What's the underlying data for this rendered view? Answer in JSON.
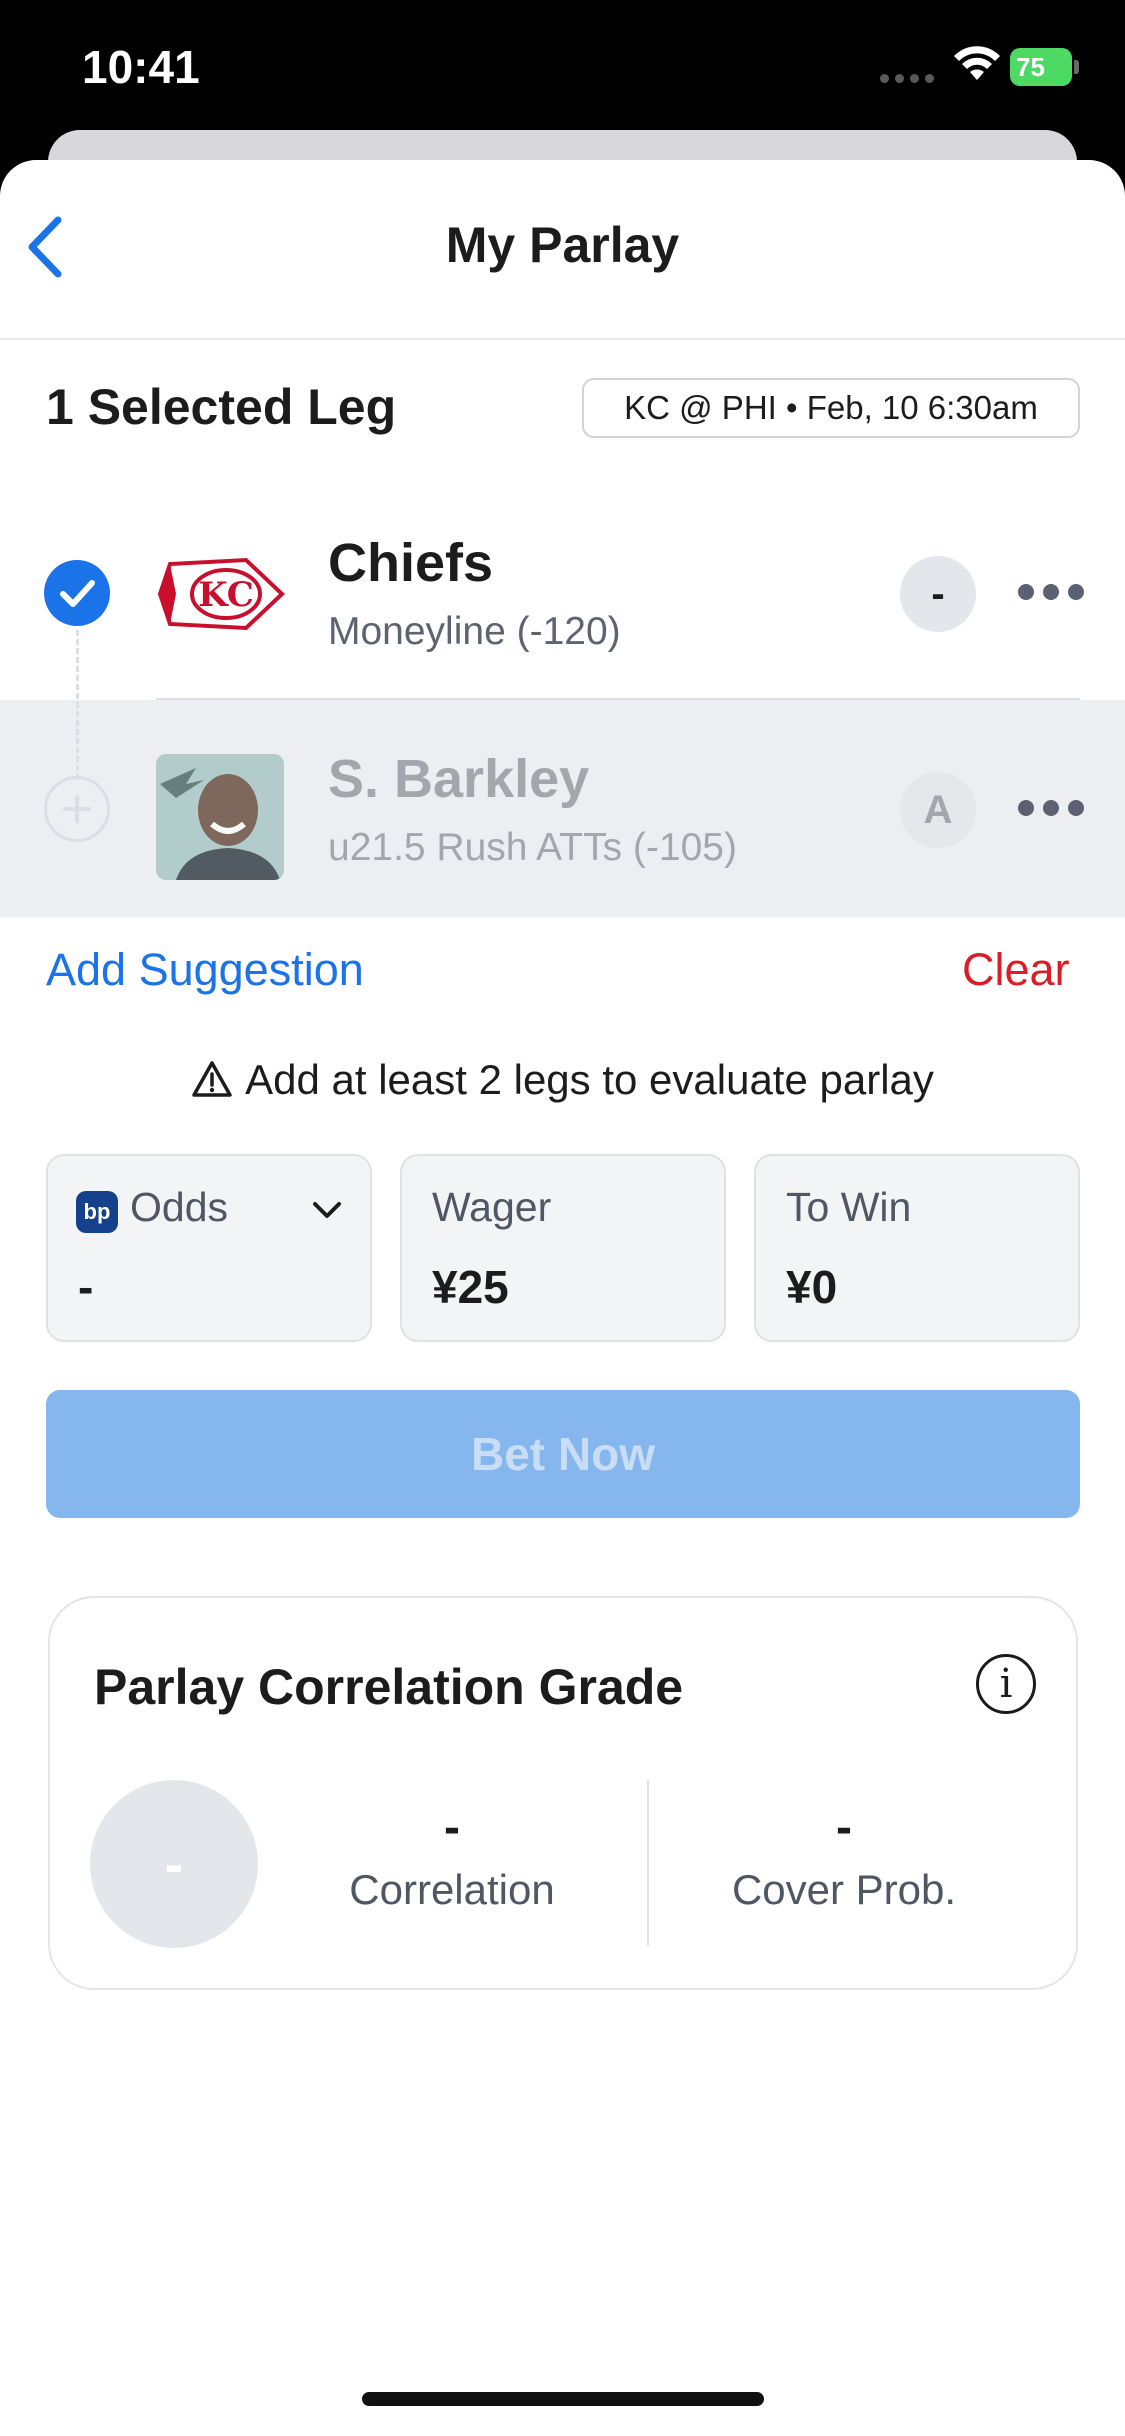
{
  "status_bar": {
    "time": "10:41",
    "battery": "75"
  },
  "header": {
    "title": "My Parlay"
  },
  "summary": {
    "legs_count": "1 Selected Leg",
    "game_chip": "KC @ PHI • Feb, 10 6:30am"
  },
  "legs": [
    {
      "selected": true,
      "name": "Chiefs",
      "market": "Moneyline (-120)",
      "grade": "-",
      "logo": "kc-chiefs-logo"
    },
    {
      "selected": false,
      "name": "S. Barkley",
      "market": "u21.5 Rush ATTs (-105)",
      "grade": "A",
      "logo": "player-headshot"
    }
  ],
  "actions": {
    "add_suggestion": "Add Suggestion",
    "clear": "Clear"
  },
  "warning": "Add at least 2 legs to evaluate parlay",
  "bet_inputs": {
    "odds_label": "Odds",
    "odds_value": "-",
    "wager_label": "Wager",
    "wager_value": "¥25",
    "to_win_label": "To Win",
    "to_win_value": "¥0"
  },
  "bet_button": "Bet Now",
  "grade_card": {
    "title": "Parlay Correlation Grade",
    "grade": "-",
    "correlation_value": "-",
    "correlation_label": "Correlation",
    "cover_value": "-",
    "cover_label": "Cover Prob."
  },
  "colors": {
    "accent": "#1a73e8",
    "danger": "#d91f26",
    "bet_disabled": "#86b6ee"
  }
}
